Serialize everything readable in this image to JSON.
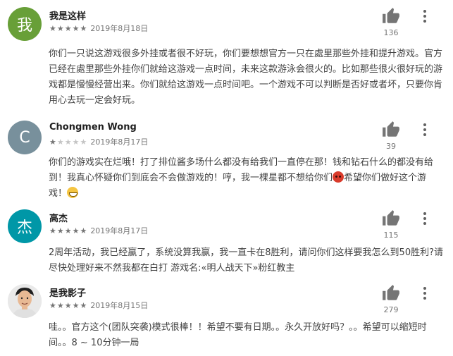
{
  "reviews": [
    {
      "avatar_text": "我",
      "avatar_color": "#689f38",
      "name": "我是这样",
      "rating": 5,
      "date": "2019年8月18日",
      "likes": "136",
      "text": "你们一只说这游戏很多外挂或者很不好玩，你们要想想官方一只在處里那些外挂和提升游戏。官方已经在處里那些外挂你们就给这游戏一点时间，未来这款游泳会很火的。比如那些很火很好玩的游戏都是慢慢经营出来。你们就给这游戏一点时间吧。一个游戏不可以判断是否好或者坏，只要你肯用心去玩一定会好玩。"
    },
    {
      "avatar_text": "C",
      "avatar_color": "#78909c",
      "name": "Chongmen Wong",
      "rating": 1,
      "date": "2019年8月17日",
      "likes": "39",
      "text": "你们的游戏实在烂哦！打了排位酱多场什么都没有给我们一直停在那！钱和钻石什么的都没有给到！我真心怀疑你们到底会不会做游戏的！哼，我一棵星都不想给你们",
      "text_after": "希望你们做好这个游戏！"
    },
    {
      "avatar_text": "杰",
      "avatar_color": "#0097a7",
      "name": "高杰",
      "rating": 5,
      "date": "2019年8月17日",
      "likes": "115",
      "text": "2周年活动，我已经赢了，系统没算我赢，我一直卡在8胜利，请问你们这样要我怎么到50胜利?请尽快处理好来不然我都在白打 游戏名:«明人战天下»粉红教主"
    },
    {
      "avatar_text": "",
      "avatar_color": "#dcdcdc",
      "name": "是我影子",
      "rating": 5,
      "date": "2019年8月15日",
      "likes": "279",
      "text": "哇。。官方这个(团队突袭)模式很棒！！希望不要有日期。。永久开放好吗？。。希望可以缩短时间。。8 ~ 10分钟一局"
    }
  ]
}
